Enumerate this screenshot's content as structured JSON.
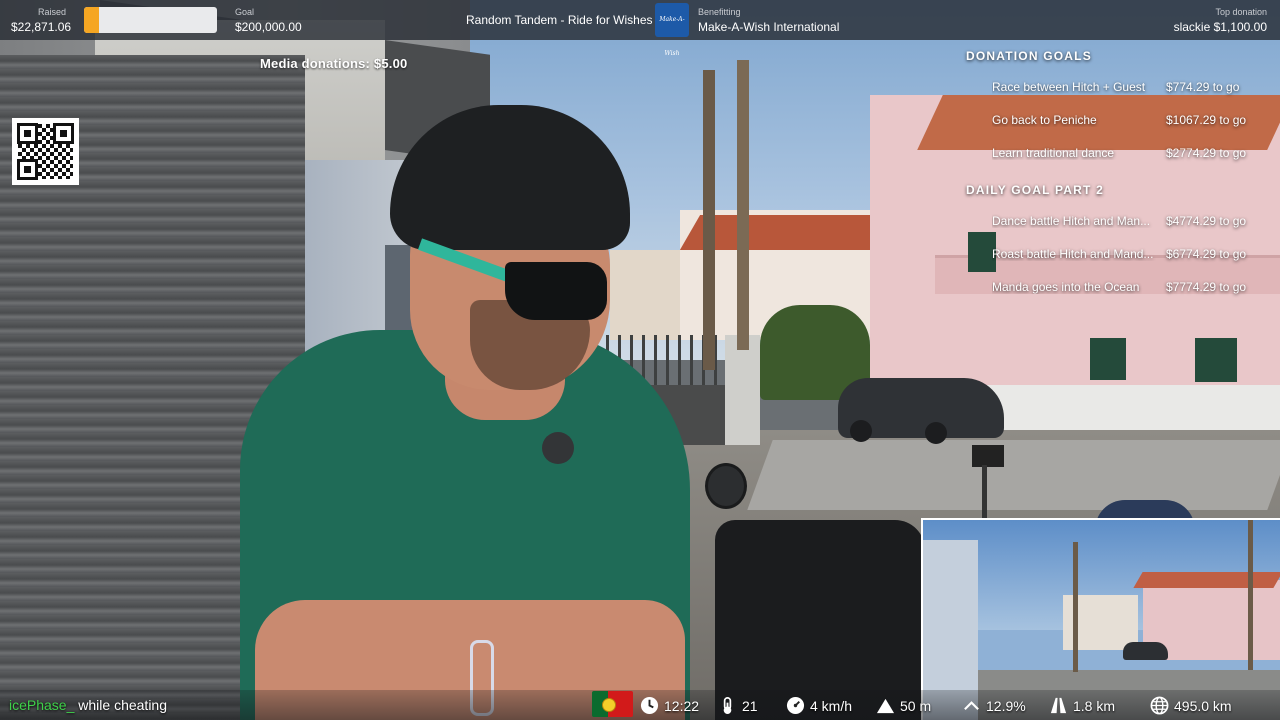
{
  "top_bar": {
    "raised_label": "Raised",
    "raised_value": "$22,871.06",
    "goal_label": "Goal",
    "goal_value": "$200,000.00",
    "progress_fraction": 0.114,
    "progress_color": "#f5a623",
    "stream_title": "Random Tandem - Ride for Wishes",
    "benefitting_label": "Benefitting",
    "charity_name": "Make-A-Wish International",
    "charity_logo_text": "Make-A-Wish",
    "top_donation_label": "Top donation",
    "top_donation_value": "slackie $1,100.00"
  },
  "media_donations": "Media donations: $5.00",
  "qr_code": {
    "icon": "qr-code-icon"
  },
  "donation_goals": {
    "title": "DONATION GOALS",
    "items": [
      {
        "name": "Race between Hitch + Guest",
        "amount": "$774.29 to go"
      },
      {
        "name": "Go back to Peniche",
        "amount": "$1067.29 to go"
      },
      {
        "name": "Learn traditional dance",
        "amount": "$2774.29 to go"
      }
    ]
  },
  "daily_goal": {
    "title": "DAILY GOAL PART 2",
    "items": [
      {
        "name": "Dance battle Hitch and Man...",
        "amount": "$4774.29 to go"
      },
      {
        "name": "Roast battle Hitch and Mand...",
        "amount": "$6774.29 to go"
      },
      {
        "name": "Manda goes into the Ocean",
        "amount": "$7774.29 to go"
      }
    ]
  },
  "chat": {
    "username": "icePhase_",
    "message": "while cheating"
  },
  "status_bar": {
    "flag": "portugal-flag",
    "time": "12:22",
    "temperature": "21",
    "speed": "4 km/h",
    "altitude": "50 m",
    "incline": "12.9%",
    "distance": "1.8 km",
    "total_distance": "495.0 km"
  }
}
